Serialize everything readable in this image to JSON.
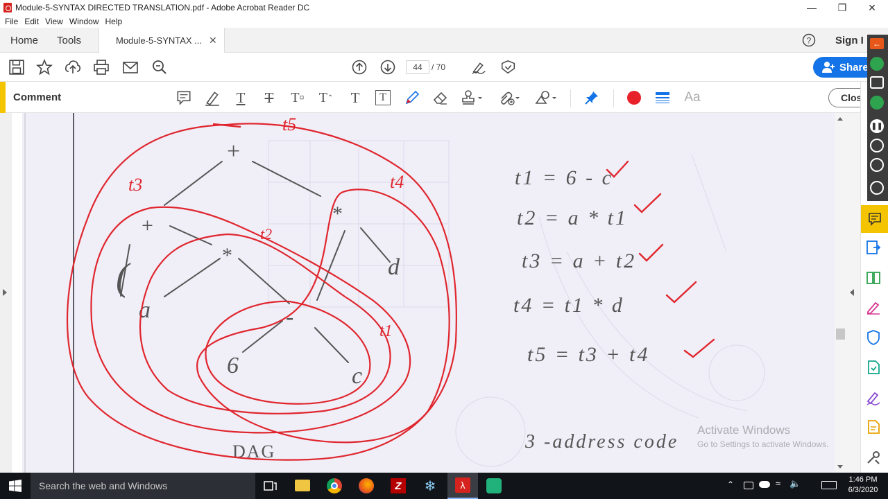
{
  "window": {
    "title": "Module-5-SYNTAX DIRECTED TRANSLATION.pdf - Adobe Acrobat Reader DC"
  },
  "menu": {
    "items": [
      "File",
      "Edit",
      "View",
      "Window",
      "Help"
    ]
  },
  "tabs": {
    "home": "Home",
    "tools": "Tools",
    "doc": "Module-5-SYNTAX ...",
    "sign": "Sign I"
  },
  "toolbar": {
    "page_current": "44",
    "page_total": "/ 70",
    "share_label": "Share"
  },
  "comment": {
    "title": "Comment",
    "close_label": "Close",
    "font_label": "Aa",
    "color": "#e8202a"
  },
  "page": {
    "tree_labels": [
      "+",
      "+",
      "*",
      "*",
      "-",
      "(",
      "a",
      "6",
      "c",
      "d"
    ],
    "region_labels": [
      "t5",
      "t3",
      "t4",
      "t2",
      "t1"
    ],
    "caption": "DAG",
    "equations": [
      "t1 = 6 - c",
      "t2 = a * t1",
      "t3 = a + t2",
      "t4 = t1 * d",
      "t5 = t3 + t4"
    ],
    "footer_text": "3 -address code"
  },
  "watermark": {
    "line1": "Activate Windows",
    "line2": "Go to Settings to activate Windows."
  },
  "taskbar": {
    "search_placeholder": "Search the web and Windows",
    "time": "1:46 PM",
    "date": "6/3/2020"
  },
  "icons": [
    "pdf-icon",
    "save-icon",
    "star-icon",
    "upload-icon",
    "print-icon",
    "email-icon",
    "zoom-icon",
    "page-up-icon",
    "page-down-icon",
    "sign-icon",
    "stamp-icon",
    "help-icon",
    "pin-icon"
  ]
}
